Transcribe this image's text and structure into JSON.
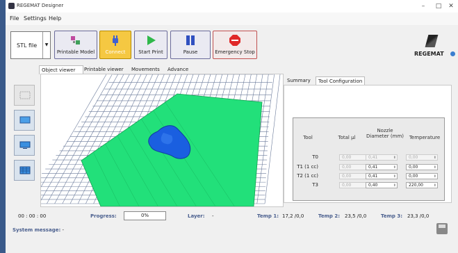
{
  "window": {
    "title": "REGEMAT Designer",
    "controls": {
      "minimize": "–",
      "maximize": "□",
      "close": "✕"
    }
  },
  "menu": [
    "File",
    "Settings",
    "Help"
  ],
  "toolbar": {
    "stl_label": "STL file",
    "buttons": [
      {
        "label": "Printable Model",
        "icon": "printable-model-icon"
      },
      {
        "label": "Connect",
        "icon": "plug-icon",
        "color": "#f5c842"
      },
      {
        "label": "Start Print",
        "icon": "play-icon",
        "color": "#2fb84a"
      },
      {
        "label": "Pause",
        "icon": "pause-icon",
        "color": "#3050c0"
      },
      {
        "label": "Emergency Stop",
        "icon": "stop-sign-icon",
        "color": "#e02828"
      }
    ]
  },
  "logo": {
    "text": "REGEMAT"
  },
  "viewer_tabs": [
    "Object viewer",
    "Printable viewer",
    "Movements",
    "Advance"
  ],
  "panel_tabs": [
    "Summary",
    "Tool Configuration"
  ],
  "tool_table": {
    "headers": [
      "Tool",
      "Total µl",
      "Nozzle Diameter (mm)",
      "Temperature"
    ],
    "rows": [
      {
        "tool": "T0",
        "total": "0,00",
        "nozzle": "0,41",
        "temp": "0,00",
        "enabled": false
      },
      {
        "tool": "T1 (1 cc)",
        "total": "0,00",
        "nozzle": "0,41",
        "temp": "0,00",
        "enabled": true
      },
      {
        "tool": "T2 (1 cc)",
        "total": "0,00",
        "nozzle": "0,41",
        "temp": "0,00",
        "enabled": true
      },
      {
        "tool": "T3",
        "total": "0,00",
        "nozzle": "0,40",
        "temp": "220,00",
        "enabled": true
      }
    ]
  },
  "status": {
    "time": "00 : 00 : 00",
    "progress_label": "Progress:",
    "progress": "0%",
    "layer_label": "Layer:",
    "layer": "-",
    "temp1_label": "Temp 1:",
    "temp1": "17,2 /0,0",
    "temp2_label": "Temp 2:",
    "temp2": "23,5 /0,0",
    "temp3_label": "Temp 3:",
    "temp3": "23,3 /0,0",
    "system_label": "System message:",
    "system": "-"
  },
  "colors": {
    "platform": "#22e07a",
    "model": "#1a5fe0",
    "grid": "#6a7a9a"
  }
}
